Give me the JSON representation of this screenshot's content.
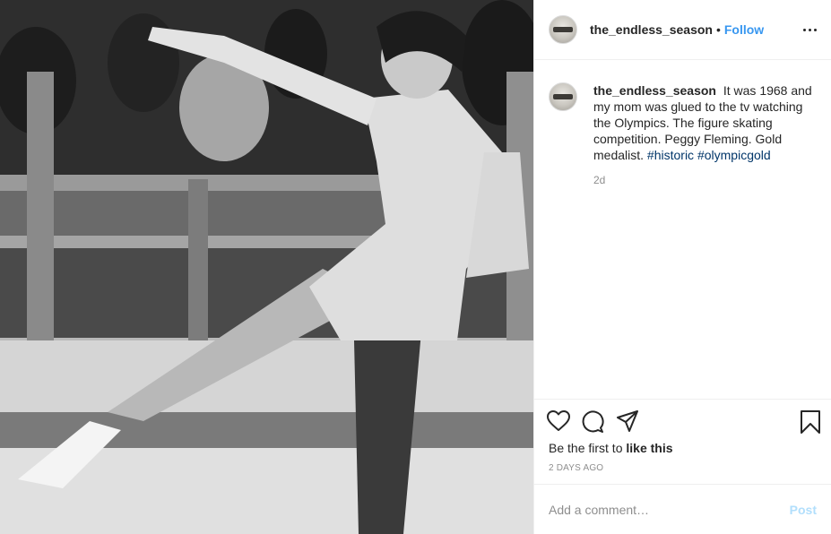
{
  "post": {
    "username": "the_endless_season",
    "separator": "•",
    "follow_label": "Follow",
    "more_icon": "more-options-icon",
    "caption_username": "the_endless_season",
    "caption_text": "It was 1968 and my mom was glued to the tv watching the Olympics. The figure skating competition. Peggy Fleming. Gold medalist.",
    "hashtags": [
      "#historic",
      "#olympicgold"
    ],
    "caption_time": "2d",
    "likes_prefix": "Be the first to",
    "likes_link": "like this",
    "age": "2 DAYS AGO",
    "comment_placeholder": "Add a comment…",
    "post_label": "Post",
    "icons": [
      "heart-icon",
      "comment-icon",
      "share-icon",
      "bookmark-icon"
    ],
    "colors": {
      "link": "#3897f0",
      "hashtag": "#003569",
      "muted": "#8e8e8e",
      "post_disabled": "#b2dffc"
    }
  }
}
